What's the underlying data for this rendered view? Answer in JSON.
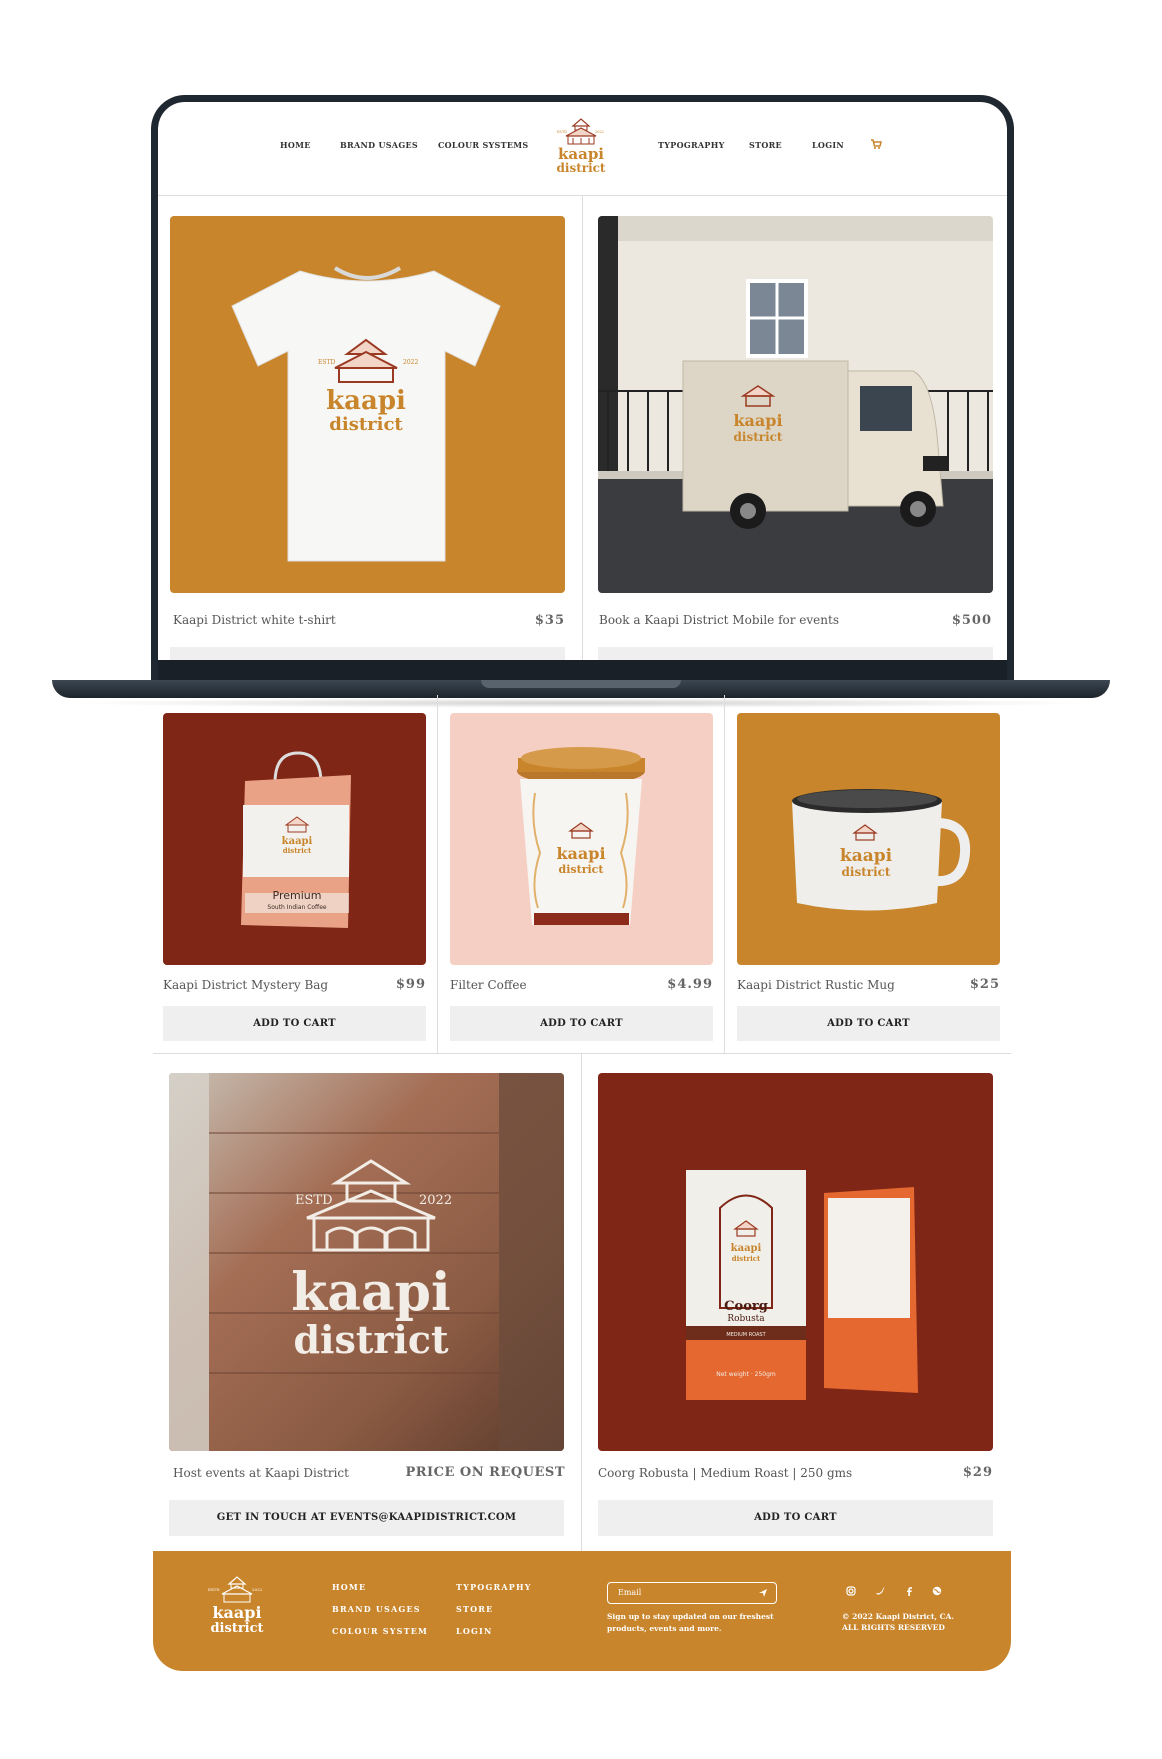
{
  "nav": {
    "home": "HOME",
    "brand_usages": "BRAND USAGES",
    "colour_systems": "COLOUR SYSTEMS",
    "typography": "TYPOGRAPHY",
    "store": "STORE",
    "login": "LOGIN",
    "cart_icon": "cart-icon"
  },
  "logo": {
    "estd": "ESTD",
    "year": "2022",
    "word1": "kaapi",
    "word2": "district"
  },
  "products": [
    {
      "name": "Kaapi District white t-shirt",
      "price": "$35"
    },
    {
      "name": "Book a Kaapi District Mobile for events",
      "price": "$500"
    },
    {
      "name": "Kaapi District Mystery Bag",
      "price": "$99",
      "button": "ADD TO CART"
    },
    {
      "name": "Filter Coffee",
      "price": "$4.99",
      "button": "ADD TO CART"
    },
    {
      "name": "Kaapi District Rustic Mug",
      "price": "$25",
      "button": "ADD TO CART"
    },
    {
      "name": "Host events at Kaapi District",
      "price": "PRICE ON REQUEST",
      "button": "GET IN TOUCH AT EVENTS@KAAPIDISTRICT.COM"
    },
    {
      "name": "Coorg Robusta | Medium Roast | 250 gms",
      "price": "$29",
      "button": "ADD TO CART"
    }
  ],
  "mockup_text": {
    "bag_premium": "Premium",
    "bag_sub": "South Indian Coffee",
    "pouch_name": "Coorg",
    "pouch_sub": "Robusta",
    "pouch_roast": "MEDIUM ROAST",
    "pouch_weight": "Net weight · 250gm"
  },
  "footer": {
    "links_col1": [
      "HOME",
      "BRAND USAGES",
      "COLOUR SYSTEM"
    ],
    "links_col2": [
      "TYPOGRAPHY",
      "STORE",
      "LOGIN"
    ],
    "email_placeholder": "Email",
    "signup_line1": "Sign up to stay updated on our freshest",
    "signup_line2": "products, events and more.",
    "copyright_line1": "© 2022 Kaapi District, CA.",
    "copyright_line2": "ALL RIGHTS RESERVED",
    "social_icons": [
      "instagram-icon",
      "twitter-icon",
      "facebook-icon",
      "globe-icon"
    ]
  },
  "colors": {
    "mustard": "#c8852b",
    "maroon": "#7f2616",
    "blush": "#f6cfc4",
    "logo_red": "#9b3a22"
  }
}
